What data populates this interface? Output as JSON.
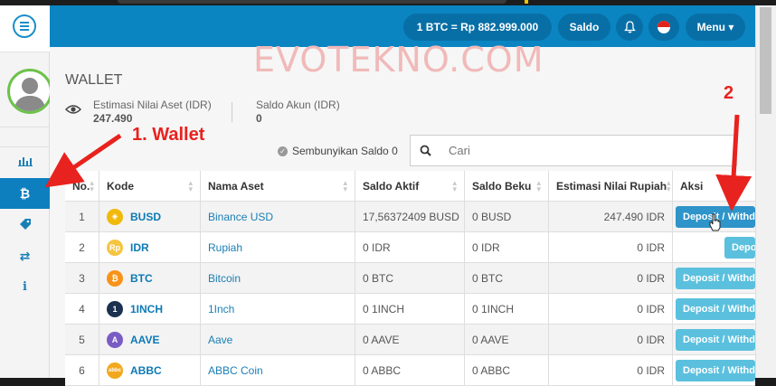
{
  "topbar": {
    "rate": "1 BTC = Rp 882.999.000",
    "saldo_label": "Saldo",
    "menu_label": "Menu ▾"
  },
  "watermark": "EVOTEKNO.COM",
  "page": {
    "title": "WALLET",
    "estimasi_label": "Estimasi Nilai Aset (IDR)",
    "estimasi_value": "247.490",
    "saldo_akun_label": "Saldo Akun (IDR)",
    "saldo_akun_value": "0"
  },
  "annotations": {
    "wallet": "1. Wallet",
    "two": "2"
  },
  "controls": {
    "hide_balance": "Sembunyikan Saldo 0",
    "search_placeholder": "Cari"
  },
  "table": {
    "headers": [
      "No.",
      "Kode",
      "Nama Aset",
      "Saldo Aktif",
      "Saldo Beku",
      "Estimasi Nilai Rupiah",
      "Aksi"
    ],
    "rows": [
      {
        "no": "1",
        "kode": "BUSD",
        "nama": "Binance USD",
        "aktif": "17,56372409 BUSD",
        "beku": "0 BUSD",
        "est": "247.490 IDR",
        "aksi": "Deposit / Withdraw",
        "coin_color": "#f0b90b",
        "coin_glyph": "◈"
      },
      {
        "no": "2",
        "kode": "IDR",
        "nama": "Rupiah",
        "aktif": "0 IDR",
        "beku": "0 IDR",
        "est": "0 IDR",
        "aksi": "Deposit",
        "coin_color": "#f5c542",
        "coin_glyph": "Rp"
      },
      {
        "no": "3",
        "kode": "BTC",
        "nama": "Bitcoin",
        "aktif": "0 BTC",
        "beku": "0 BTC",
        "est": "0 IDR",
        "aksi": "Deposit / Withdraw",
        "coin_color": "#f7931a",
        "coin_glyph": "₿"
      },
      {
        "no": "4",
        "kode": "1INCH",
        "nama": "1Inch",
        "aktif": "0 1INCH",
        "beku": "0 1INCH",
        "est": "0 IDR",
        "aksi": "Deposit / Withdraw",
        "coin_color": "#1b314f",
        "coin_glyph": "1"
      },
      {
        "no": "5",
        "kode": "AAVE",
        "nama": "Aave",
        "aktif": "0 AAVE",
        "beku": "0 AAVE",
        "est": "0 IDR",
        "aksi": "Deposit / Withdraw",
        "coin_color": "#7a5cc4",
        "coin_glyph": "A"
      },
      {
        "no": "6",
        "kode": "ABBC",
        "nama": "ABBC Coin",
        "aktif": "0 ABBC",
        "beku": "0 ABBC",
        "est": "0 IDR",
        "aksi": "Deposit / Withdraw",
        "coin_color": "#f2a81d",
        "coin_glyph": "abbc"
      }
    ]
  },
  "colors": {
    "primary": "#0a85c2",
    "active_nav": "#0d7fbf",
    "action_button": "#5bc0de",
    "annotation_red": "#e8221e"
  },
  "sidebar_icons": [
    "bar-chart-icon",
    "bitcoin-icon",
    "tag-icon",
    "transfer-icon",
    "info-icon"
  ]
}
